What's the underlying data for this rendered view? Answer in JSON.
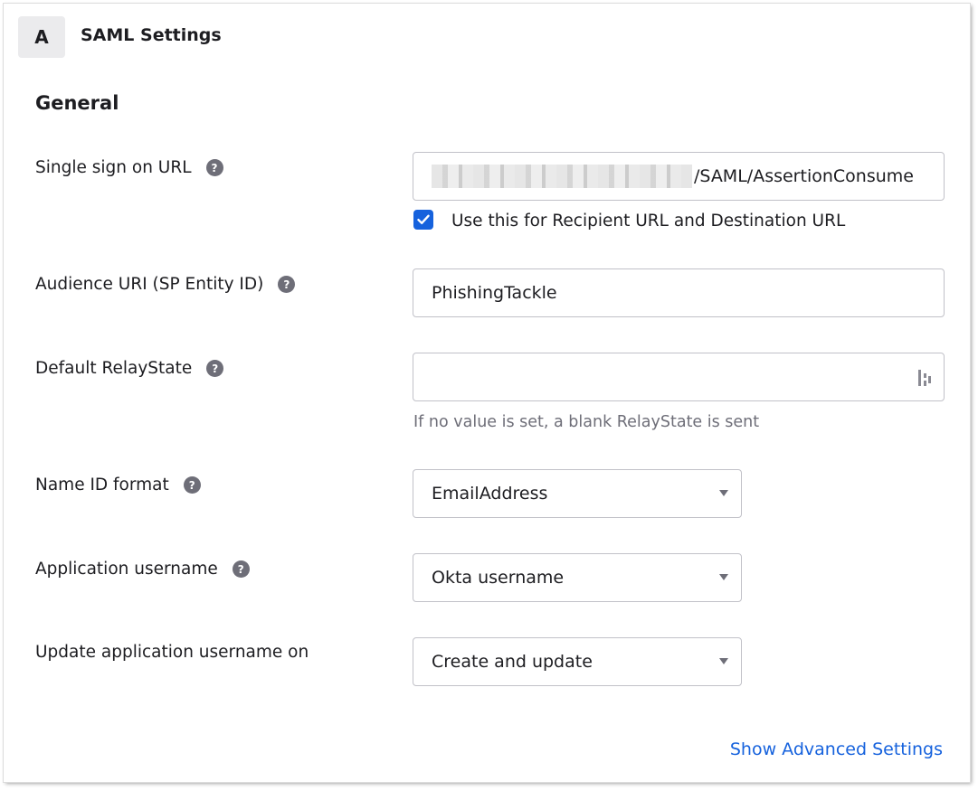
{
  "panel": {
    "step": "A",
    "title": "SAML Settings",
    "section_title": "General"
  },
  "fields": {
    "sso_url": {
      "label": "Single sign on URL",
      "value_suffix": "/SAML/AssertionConsume",
      "redacted": true
    },
    "recipient_checkbox": {
      "label": "Use this for Recipient URL and Destination URL",
      "checked": true
    },
    "audience_uri": {
      "label": "Audience URI (SP Entity ID)",
      "value": "PhishingTackle"
    },
    "relay_state": {
      "label": "Default RelayState",
      "value": "",
      "hint": "If no value is set, a blank RelayState is sent"
    },
    "name_id_format": {
      "label": "Name ID format",
      "value": "EmailAddress"
    },
    "app_username": {
      "label": "Application username",
      "value": "Okta username"
    },
    "update_username_on": {
      "label": "Update application username on",
      "value": "Create and update"
    }
  },
  "advanced_link": "Show Advanced Settings",
  "help_icon_glyph": "?",
  "colors": {
    "accent": "#1662dd",
    "help_icon": "#6e6e78",
    "hint_text": "#6e6e78",
    "border": "#c1c1c8"
  }
}
